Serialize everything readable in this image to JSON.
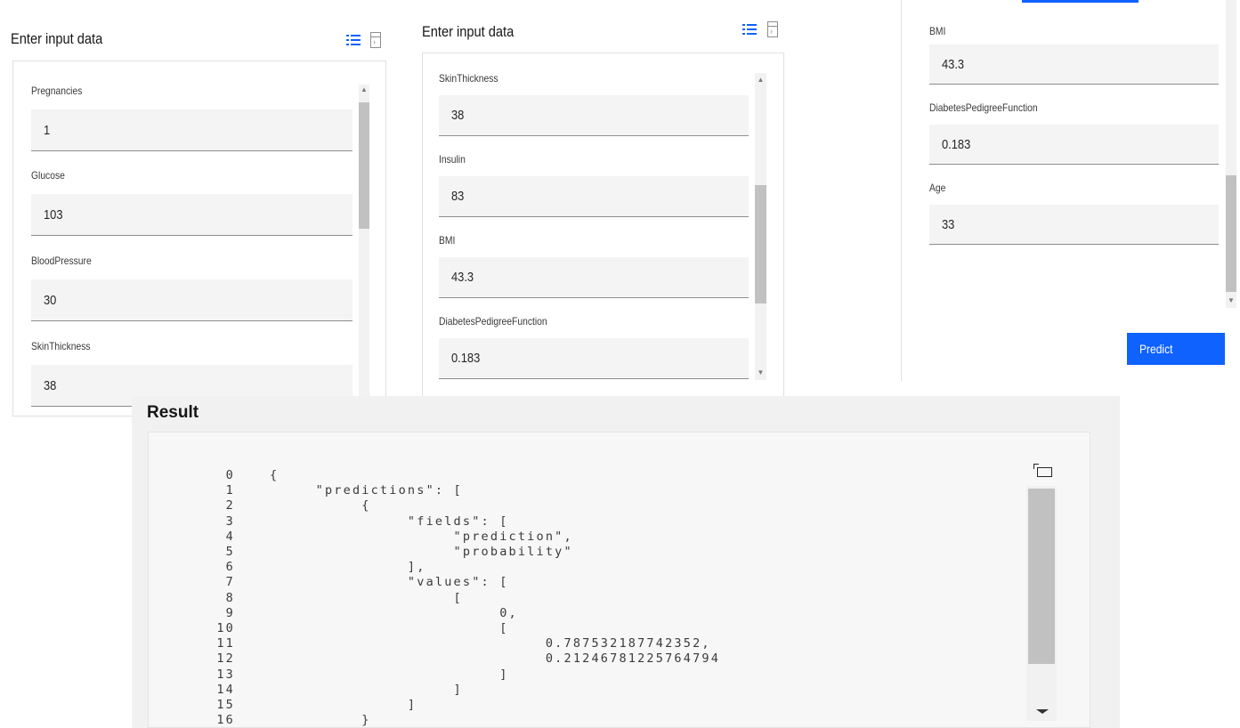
{
  "panel1": {
    "title": "Enter input data",
    "fields": [
      {
        "label": "Pregnancies",
        "value": "1"
      },
      {
        "label": "Glucose",
        "value": "103"
      },
      {
        "label": "BloodPressure",
        "value": "30"
      },
      {
        "label": "SkinThickness",
        "value": "38"
      }
    ]
  },
  "panel2": {
    "title": "Enter input data",
    "fields": [
      {
        "label": "SkinThickness",
        "value": "38"
      },
      {
        "label": "Insulin",
        "value": "83"
      },
      {
        "label": "BMI",
        "value": "43.3"
      },
      {
        "label": "DiabetesPedigreeFunction",
        "value": "0.183"
      }
    ]
  },
  "panel3": {
    "fields": [
      {
        "label": "BMI",
        "value": "43.3"
      },
      {
        "label": "DiabetesPedigreeFunction",
        "value": "0.183"
      },
      {
        "label": "Age",
        "value": "33"
      }
    ],
    "predict_label": "Predict"
  },
  "result": {
    "title": "Result",
    "line_numbers": [
      "0",
      "1",
      "2",
      "3",
      "4",
      "5",
      "6",
      "7",
      "8",
      "9",
      "10",
      "11",
      "12",
      "13",
      "14",
      "15",
      "16"
    ],
    "lines": [
      "{",
      "     \"predictions\": [",
      "          {",
      "               \"fields\": [",
      "                    \"prediction\",",
      "                    \"probability\"",
      "               ],",
      "               \"values\": [",
      "                    [",
      "                         0,",
      "                         [",
      "                              0.787532187742352,",
      "                              0.21246781225764794",
      "                         ]",
      "                    ]",
      "               ]",
      "          }"
    ]
  },
  "colors": {
    "accent": "#0f62fe",
    "field_bg": "#f4f4f4",
    "code_bg": "#f7f7f7"
  },
  "icons": [
    "list-view-icon",
    "document-view-icon",
    "copy-icon",
    "scroll-up-arrow-icon",
    "scroll-down-arrow-icon"
  ]
}
